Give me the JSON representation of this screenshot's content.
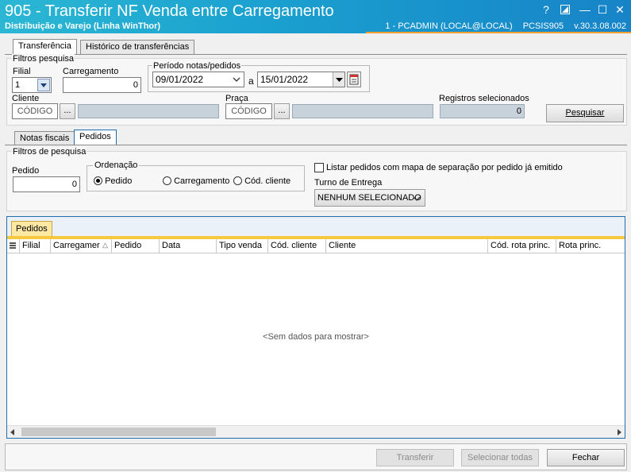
{
  "window": {
    "title": "905 - Transferir NF Venda entre Carregamento",
    "subtitle": "Distribuição e Varejo (Linha WinThor)",
    "user_info": "1 - PCADMIN (LOCAL@LOCAL)",
    "routine": "PCSIS905",
    "version": "v.30.3.08.002",
    "help_glyph": "?",
    "minimize_glyph": "—",
    "maximize_glyph": "☐",
    "close_glyph": "✕"
  },
  "main_tabs": [
    {
      "label": "Transferência",
      "active": true
    },
    {
      "label": "Histórico de transferências",
      "active": false
    }
  ],
  "filtros": {
    "group_label": "Filtros pesquisa",
    "filial_label": "Filial",
    "filial_value": "1",
    "carregamento_label": "Carregamento",
    "carregamento_value": "0",
    "periodo_label": "Período notas/pedidos",
    "date_from": "09/01/2022",
    "date_sep": "a",
    "date_to": "15/01/2022",
    "cliente_label": "Cliente",
    "cliente_codigo": "CÓDIGO",
    "ellipsis": "...",
    "praca_label": "Praça",
    "praca_codigo": "CÓDIGO",
    "registros_label": "Registros selecionados",
    "registros_value": "0",
    "pesquisar_label": "Pesquisar"
  },
  "sub_tabs": [
    {
      "label": "Notas fiscais",
      "active": false
    },
    {
      "label": "Pedidos",
      "active": true
    }
  ],
  "pedidos_filtros": {
    "group_label": "Filtros de pesquisa",
    "pedido_label": "Pedido",
    "pedido_value": "0",
    "ordenacao_label": "Ordenação",
    "ordenacao_options": [
      "Pedido",
      "Carregamento",
      "Cód. cliente"
    ],
    "ordenacao_selected": "Pedido",
    "listar_label": "Listar pedidos com mapa de separação por pedido já emitido",
    "listar_checked": false,
    "turno_label": "Turno de Entrega",
    "turno_value": "NENHUM SELECIONADO"
  },
  "grid": {
    "tab_label": "Pedidos",
    "columns": [
      "Filial",
      "Carregamer",
      "Pedido",
      "Data",
      "Tipo venda",
      "Cód. cliente",
      "Cliente",
      "Cód. rota princ.",
      "Rota princ."
    ],
    "empty_text": "<Sem dados para mostrar>"
  },
  "footer": {
    "transferir_label": "Transferir",
    "selecionar_label": "Selecionar todas",
    "fechar_label": "Fechar"
  }
}
